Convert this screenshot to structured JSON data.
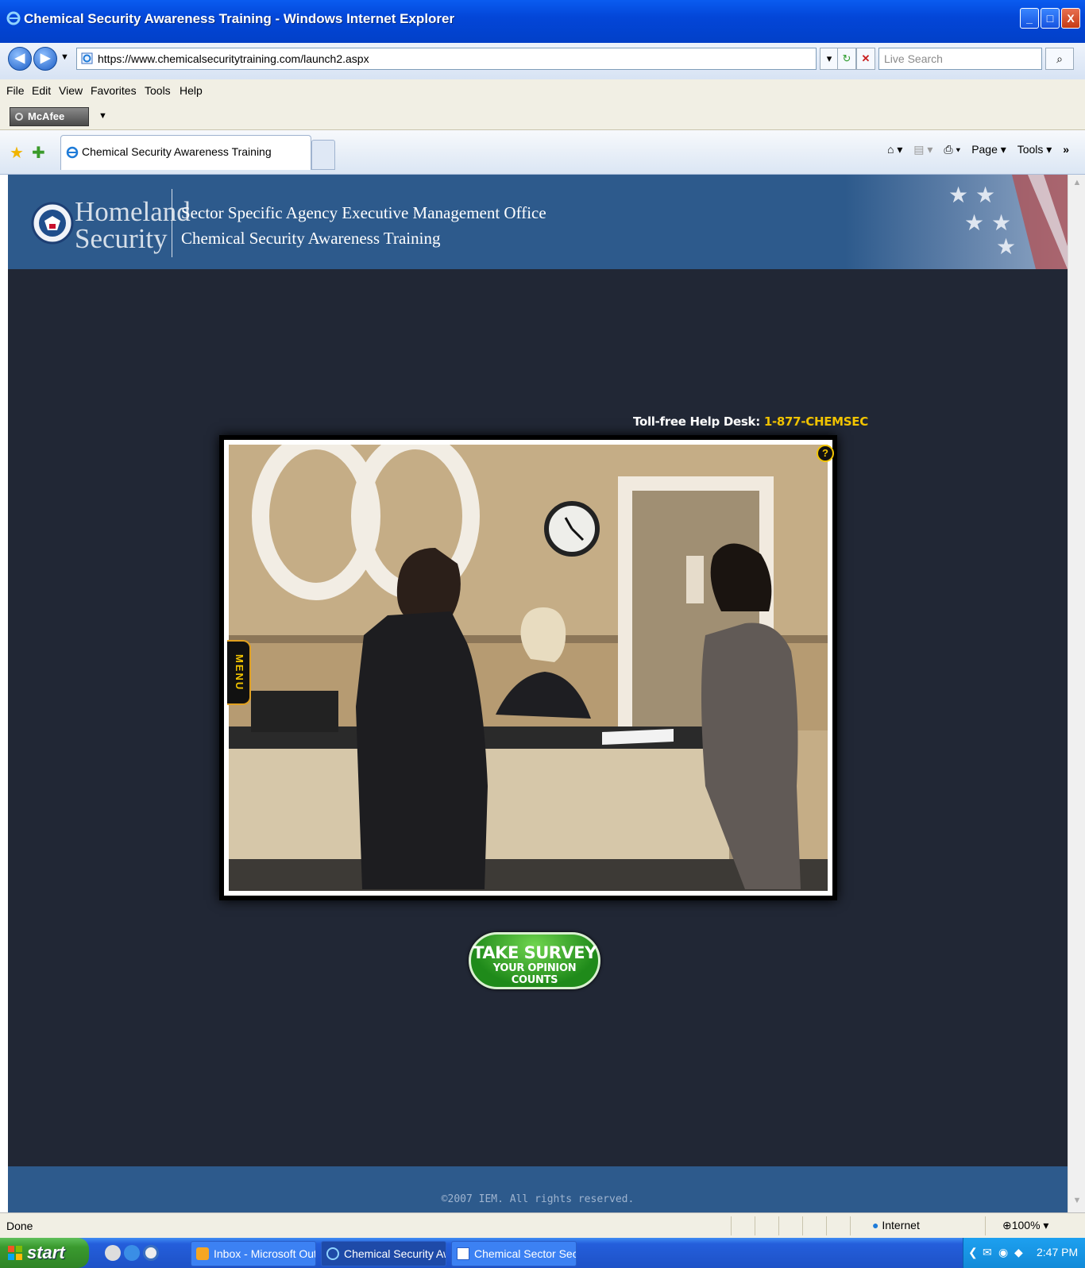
{
  "window": {
    "title": "Chemical Security Awareness Training - Windows Internet Explorer",
    "min": "_",
    "max": "□",
    "close": "X"
  },
  "addressbar": {
    "back": "◀",
    "forward": "▶",
    "url": "https://www.chemicalsecuritytraining.com/launch2.aspx",
    "search_placeholder": "Live Search"
  },
  "menu": [
    "File",
    "Edit",
    "View",
    "Favorites",
    "Tools",
    "Help"
  ],
  "mcafee": {
    "label": "McAfee"
  },
  "tab": {
    "title": "Chemical Security Awareness Training"
  },
  "commandbar": {
    "page": "Page ▾",
    "tools": "Tools ▾"
  },
  "header": {
    "logo_line1": "Homeland",
    "logo_line2": "Security",
    "subtitle1": "Sector Specific Agency Executive Management Office",
    "subtitle2": "Chemical Security Awareness Training"
  },
  "helpdesk": {
    "label": "Toll-free Help Desk:",
    "phone": "1-877-CHEMSEC"
  },
  "player": {
    "menu_label": "MENU",
    "help_label": "?"
  },
  "survey": {
    "line1": "TAKE SURVEY",
    "line2": "YOUR OPINION COUNTS"
  },
  "footer": {
    "copyright": "©2007 IEM. All rights reserved."
  },
  "status": {
    "text": "Done",
    "zone": "Internet",
    "zoom": "100%"
  },
  "taskbar": {
    "start": "start",
    "tasks": [
      "Inbox - Microsoft Out...",
      "Chemical Security Aw...",
      "Chemical Sector Secu..."
    ],
    "clock": "2:47 PM"
  }
}
